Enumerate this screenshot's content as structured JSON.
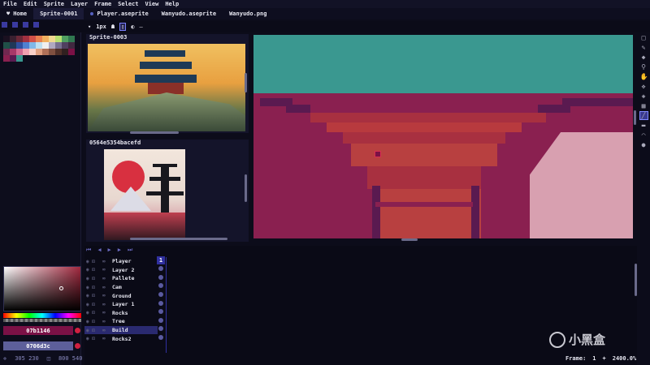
{
  "menu": [
    "File",
    "Edit",
    "Sprite",
    "Layer",
    "Frame",
    "Select",
    "View",
    "Help"
  ],
  "tabs": [
    {
      "label": "Home",
      "active": false
    },
    {
      "label": "Sprite-0001",
      "active": true
    },
    {
      "label": "Player.aseprite",
      "active": false
    },
    {
      "label": "Wanyudo.aseprite",
      "active": false
    },
    {
      "label": "Wanyudo.png",
      "active": false
    }
  ],
  "toolbar": {
    "brush_size": "1px"
  },
  "references": [
    {
      "title": "Sprite-0003"
    },
    {
      "title": "0564e5354bacefd"
    }
  ],
  "colors": {
    "primary_hex": "#7b1146",
    "secondary_hex": "#5d5f9a",
    "primary_label": "07b1146",
    "secondary_label": "0706d3c"
  },
  "status": {
    "left_coord": "305 230",
    "right_coord": "800 540"
  },
  "layers": [
    "Player",
    "Layer 2",
    "Pallete",
    "Cam",
    "Ground",
    "Layer 1",
    "Rocks",
    "Tree",
    "Build",
    "Rocks2"
  ],
  "selected_layer": "Build",
  "timeline": {
    "frame_header": "1",
    "frame_label": "Frame:",
    "frame_value": "1",
    "zoom": "2400.0%"
  },
  "watermark": "小黑盒"
}
